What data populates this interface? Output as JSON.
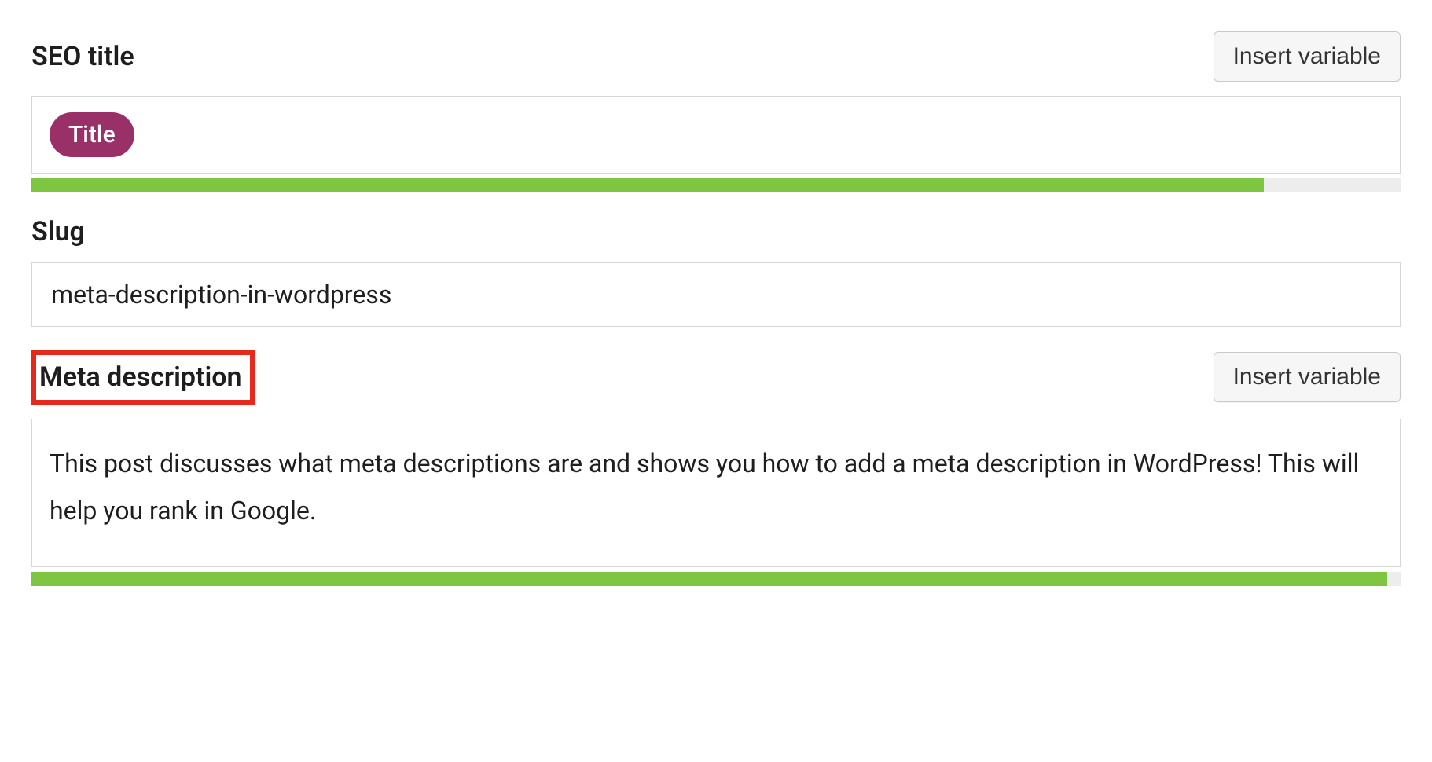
{
  "seo_title": {
    "label": "SEO title",
    "insert_button": "Insert variable",
    "variable_chip": "Title",
    "progress_percent": 90
  },
  "slug": {
    "label": "Slug",
    "value": "meta-description-in-wordpress"
  },
  "meta_description": {
    "label": "Meta description",
    "insert_button": "Insert variable",
    "value": "This post discusses what meta descriptions are and shows you how to add a meta description in WordPress! This will help you rank in Google.",
    "progress_percent": 99
  }
}
